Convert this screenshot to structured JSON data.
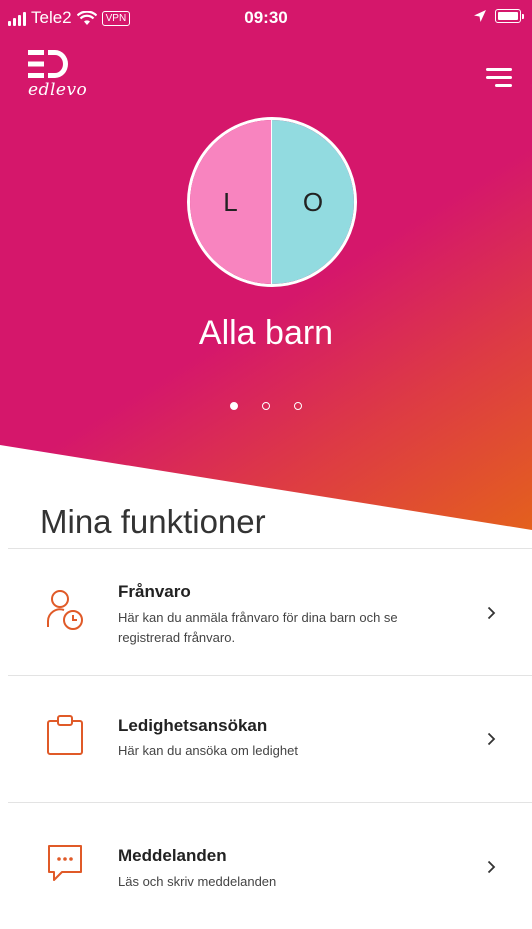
{
  "status_bar": {
    "carrier": "Tele2",
    "vpn": "VPN",
    "time": "09:30"
  },
  "brand": {
    "name": "edlevo",
    "color": "#d5176b",
    "accent": "#e05a28"
  },
  "hero": {
    "title": "Alla barn",
    "avatar": {
      "left_initial": "L",
      "right_initial": "O",
      "left_color": "#f884bf",
      "right_color": "#92dbe0"
    },
    "pager": {
      "total": 3,
      "active": 1
    }
  },
  "section_title": "Mina funktioner",
  "functions": [
    {
      "icon": "person-clock-icon",
      "title": "Frånvaro",
      "desc": "Här kan du anmäla frånvaro för dina barn och se registrerad frånvaro."
    },
    {
      "icon": "clipboard-icon",
      "title": "Ledighetsansökan",
      "desc": "Här kan du ansöka om ledighet"
    },
    {
      "icon": "chat-bubble-icon",
      "title": "Meddelanden",
      "desc": "Läs och skriv meddelanden"
    }
  ]
}
